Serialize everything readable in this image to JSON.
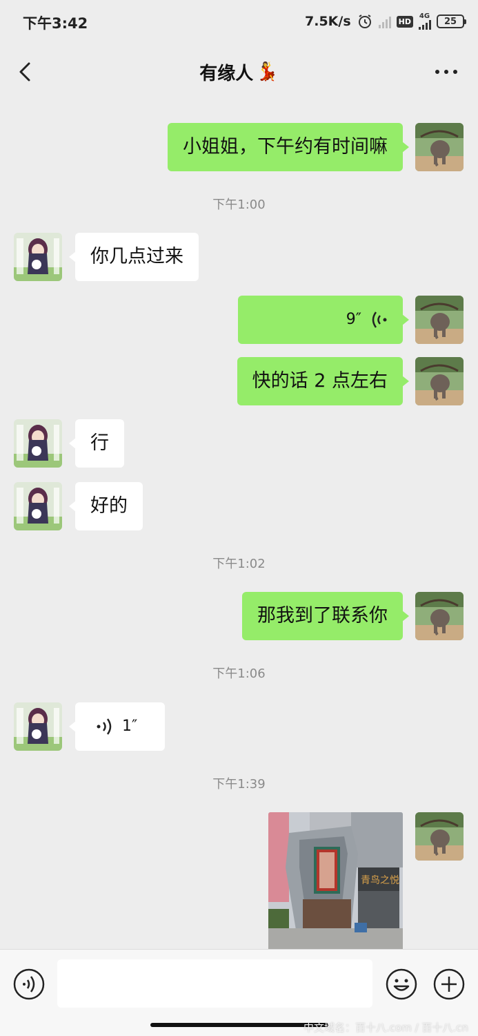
{
  "status_bar": {
    "time": "下午3:42",
    "net_speed": "7.5K/s",
    "network": "4G",
    "hd": "HD",
    "battery": "25"
  },
  "header": {
    "title": "有缘人",
    "title_emoji": "💃"
  },
  "messages": [
    {
      "kind": "text",
      "side": "out",
      "text": "小姐姐，下午约有时间嘛"
    },
    {
      "kind": "time",
      "text": "下午1:00"
    },
    {
      "kind": "text",
      "side": "in",
      "text": "你几点过来"
    },
    {
      "kind": "voice",
      "side": "out",
      "duration": "9″"
    },
    {
      "kind": "text",
      "side": "out",
      "text": "快的话 2 点左右"
    },
    {
      "kind": "text",
      "side": "in",
      "text": "行"
    },
    {
      "kind": "text",
      "side": "in",
      "text": "好的"
    },
    {
      "kind": "time",
      "text": "下午1:02"
    },
    {
      "kind": "text",
      "side": "out",
      "text": "那我到了联系你"
    },
    {
      "kind": "time",
      "text": "下午1:06"
    },
    {
      "kind": "voice",
      "side": "in",
      "duration": "1″"
    },
    {
      "kind": "time",
      "text": "下午1:39"
    },
    {
      "kind": "image",
      "side": "out",
      "sign_text": "青鸟之悦"
    }
  ],
  "input_bar": {
    "placeholder": ""
  },
  "watermark": "中文域名：百十八.com / 百十八.cn",
  "colors": {
    "outgoing_bubble": "#95ec69",
    "incoming_bubble": "#ffffff",
    "background": "#ededed"
  },
  "icons": [
    "back-icon",
    "more-icon",
    "voice-wave-icon",
    "keyboard-voice-icon",
    "emoji-icon",
    "plus-icon"
  ]
}
